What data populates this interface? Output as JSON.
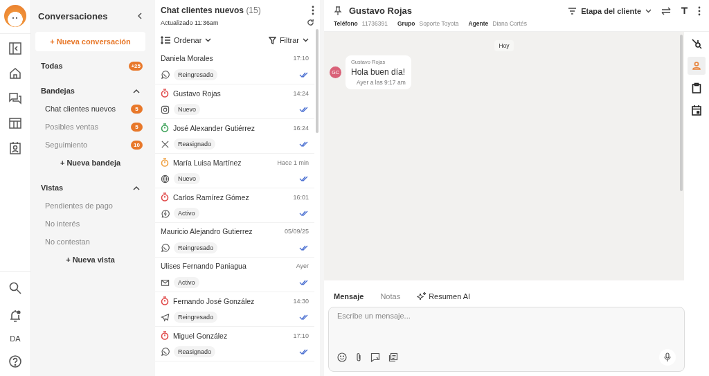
{
  "rail": {
    "items": [
      {
        "kind": "panel"
      },
      {
        "kind": "home"
      },
      {
        "kind": "chats"
      },
      {
        "kind": "table"
      },
      {
        "kind": "contact"
      }
    ],
    "bottom": [
      {
        "kind": "search"
      },
      {
        "kind": "bell"
      },
      {
        "kind": "initials",
        "text": "DA"
      },
      {
        "kind": "help"
      }
    ]
  },
  "sidebar": {
    "title": "Conversaciones",
    "new_button": "+ Nueva conversación",
    "all": {
      "label": "Todas",
      "badge": "+25"
    },
    "sections": [
      {
        "title": "Bandejas",
        "expanded": true,
        "items": [
          {
            "label": "Chat clientes nuevos",
            "badge": "5",
            "selected": true
          },
          {
            "label": "Posibles ventas",
            "badge": "5",
            "selected": false
          },
          {
            "label": "Seguimiento",
            "badge": "10",
            "selected": false
          }
        ],
        "add": "+ Nueva bandeja"
      },
      {
        "title": "Vistas",
        "expanded": true,
        "items": [
          {
            "label": "Pendientes de pago",
            "selected": false
          },
          {
            "label": "No interés",
            "selected": false
          },
          {
            "label": "No contestan",
            "selected": false
          }
        ],
        "add": "+ Nueva  vista"
      }
    ]
  },
  "list": {
    "title": "Chat clientes nuevos",
    "count": "(15)",
    "updated": "Actualizado 11:36am",
    "sort": "Ordenar",
    "filter": "Filtrar",
    "items": [
      {
        "name": "Daniela Morales",
        "time": "17:10",
        "kind": "whatsapp",
        "status": "Reingresado"
      },
      {
        "name": "Gustavo Rojas",
        "time": "14:24",
        "kind": "instagram",
        "status": "Nuevo",
        "color": "#e04848"
      },
      {
        "name": "José Alexander Gutiérrez",
        "time": "16:24",
        "kind": "x",
        "status": "Reasignado",
        "color": "#3ea35a"
      },
      {
        "name": "María Luisa Martínez",
        "time": "Hace 1 min",
        "kind": "web",
        "status": "Nuevo",
        "color": "#f0a040"
      },
      {
        "name": "Carlos Ramírez Gómez",
        "time": "16:01",
        "kind": "messenger",
        "status": "Activo",
        "color": "#e04848"
      },
      {
        "name": "Mauricio Alejandro Gutierrez",
        "time": "05/09/25",
        "kind": "whatsapp",
        "status": "Reingresado"
      },
      {
        "name": "Ulises Fernando Paniagua",
        "time": "Ayer",
        "kind": "email",
        "status": "Activo"
      },
      {
        "name": "Fernando José González",
        "time": "14:30",
        "kind": "telegram",
        "status": "Reingresado",
        "color": "#e04848"
      },
      {
        "name": "Miguel González",
        "time": "17:10",
        "kind": "whatsapp",
        "status": "Reasignado",
        "color": "#e04848"
      }
    ]
  },
  "chat": {
    "name": "Gustavo Rojas",
    "stage": "Etapa del cliente",
    "fields": [
      {
        "label": "Teléfono",
        "value": "11736391"
      },
      {
        "label": "Grupo",
        "value": "Soporte Toyota"
      },
      {
        "label": "Agente",
        "value": "Diana Cortés"
      }
    ],
    "day": "Hoy",
    "messages": [
      {
        "initials": "GC",
        "sender": "Gustavo Rojas",
        "text": "Hola buen día!",
        "time": "Ayer a las 9:17 am"
      }
    ],
    "tabs": [
      {
        "label": "Mensaje",
        "kind": "plain",
        "selected": true
      },
      {
        "label": "Notas",
        "kind": "plain",
        "selected": false
      },
      {
        "label": "Resumen AI",
        "kind": "ai",
        "selected": false
      }
    ],
    "composer": {
      "placeholder": "Escribe un mensaje..."
    }
  },
  "side_tools": [
    {
      "kind": "hub",
      "selected": false
    },
    {
      "kind": "person",
      "selected": true
    },
    {
      "kind": "clipboard",
      "selected": false
    },
    {
      "kind": "calendar",
      "selected": false
    }
  ]
}
